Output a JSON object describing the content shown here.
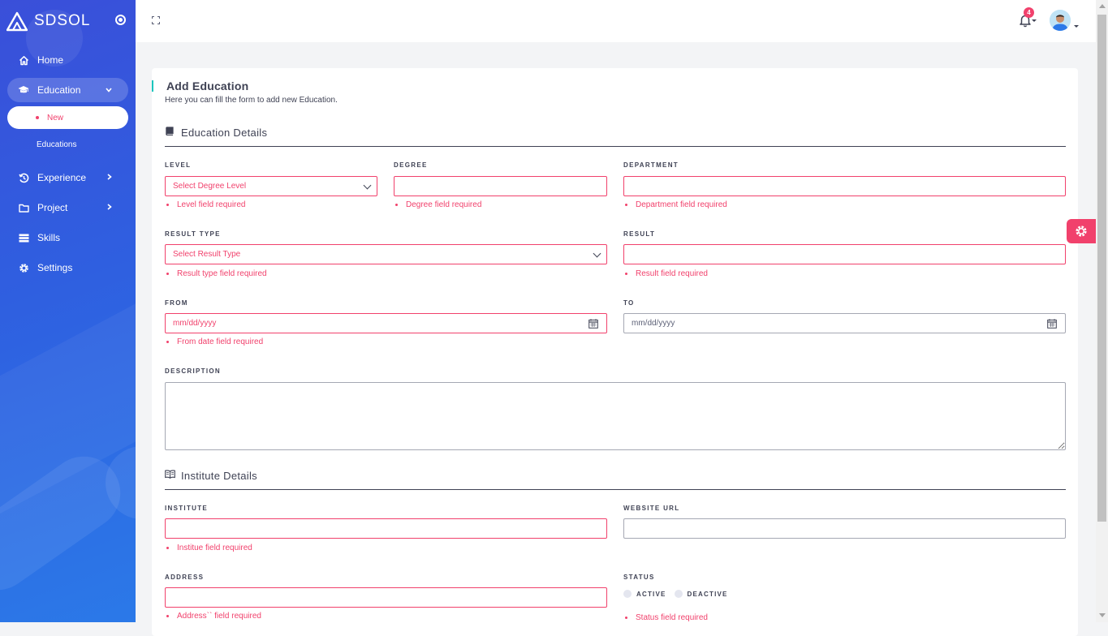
{
  "brand": {
    "name": "SDSOL"
  },
  "sidebar": {
    "items": [
      {
        "label": "Home",
        "icon": "home-icon"
      },
      {
        "label": "Education",
        "icon": "graduation-cap-icon"
      },
      {
        "label": "Experience",
        "icon": "history-icon"
      },
      {
        "label": "Project",
        "icon": "folder-icon"
      },
      {
        "label": "Skills",
        "icon": "list-icon"
      },
      {
        "label": "Settings",
        "icon": "gear-icon"
      }
    ],
    "education_sub": [
      {
        "label": "New"
      },
      {
        "label": "Educations"
      }
    ]
  },
  "topbar": {
    "notification_count": "4"
  },
  "page": {
    "title": "Add Education",
    "subtitle": "Here you can fill the form to add new Education."
  },
  "education_section": {
    "title": "Education Details",
    "level": {
      "label": "Level",
      "value": "Select Degree Level",
      "error": "Level field required"
    },
    "degree": {
      "label": "Degree",
      "value": "",
      "error": "Degree field required"
    },
    "department": {
      "label": "Department",
      "value": "",
      "error": "Department field required"
    },
    "result_type": {
      "label": "Result Type",
      "value": "Select Result Type",
      "error": "Result type field required"
    },
    "result": {
      "label": "Result",
      "value": "",
      "error": "Result field required"
    },
    "from": {
      "label": "From",
      "placeholder": "mm/dd/yyyy",
      "error": "From date field required"
    },
    "to": {
      "label": "To",
      "placeholder": "mm/dd/yyyy"
    },
    "description": {
      "label": "Description",
      "value": ""
    }
  },
  "institute_section": {
    "title": "Institute Details",
    "institute": {
      "label": "Institute",
      "value": "",
      "error": "Institue field required"
    },
    "website": {
      "label": "Website URL",
      "value": ""
    },
    "address": {
      "label": "Address",
      "value": "",
      "error": "Address`` field required"
    },
    "status": {
      "label": "Status",
      "options": [
        "Active",
        "Deactive"
      ],
      "error": "Status field required"
    }
  },
  "colors": {
    "accent": "#f1416c",
    "sidebar": "#3a4fd9",
    "teal": "#1bc5bd"
  }
}
